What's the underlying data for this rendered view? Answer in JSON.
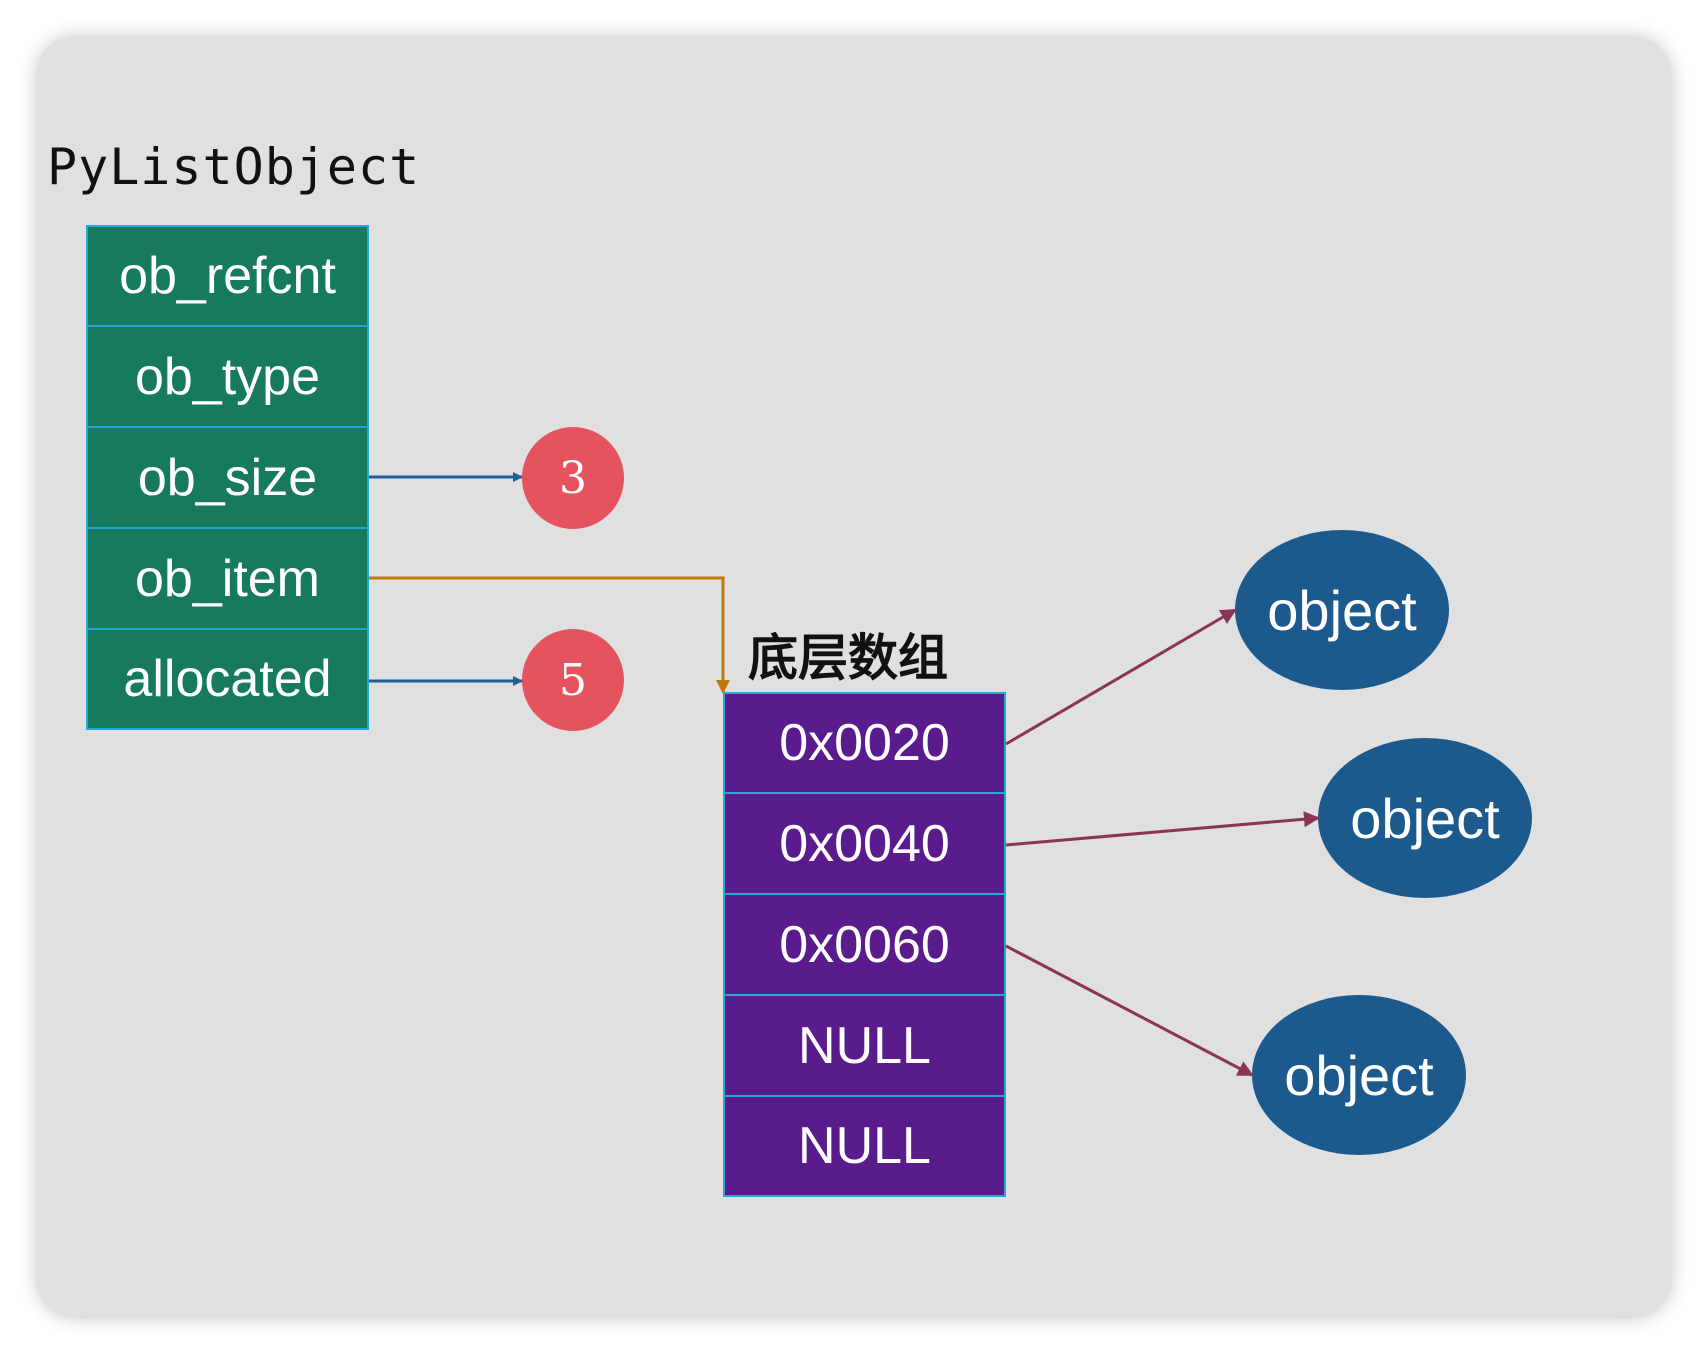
{
  "title": "PyListObject",
  "struct_fields": [
    "ob_refcnt",
    "ob_type",
    "ob_size",
    "ob_item",
    "allocated"
  ],
  "ob_size_value": "3",
  "allocated_value": "5",
  "array_label": "底层数组",
  "array_cells": [
    "0x0020",
    "0x0040",
    "0x0060",
    "NULL",
    "NULL"
  ],
  "objects": [
    "object",
    "object",
    "object"
  ],
  "colors": {
    "background": "#e0e0e0",
    "struct_fill": "#177a5e",
    "array_fill": "#5a1b8c",
    "cell_border": "#25a7d6",
    "value_circle": "#e5535e",
    "object_fill": "#1c5a8e",
    "value_arrow": "#1f5d9c",
    "item_arrow": "#c07a0a",
    "object_arrow": "#8a3558"
  }
}
